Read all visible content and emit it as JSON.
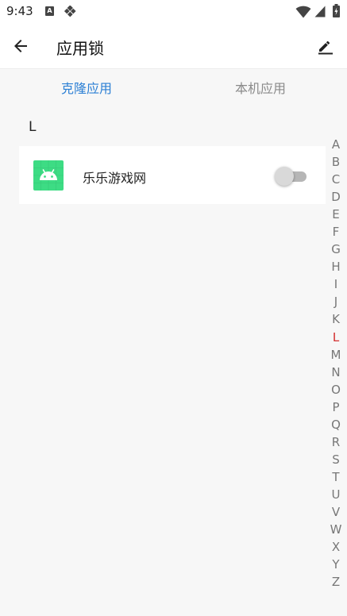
{
  "status_bar": {
    "time": "9:43",
    "a_badge": "A"
  },
  "toolbar": {
    "title": "应用锁",
    "back_icon": "arrow-left-icon",
    "edit_icon": "pencil-icon"
  },
  "tabs": [
    {
      "label": "克隆应用",
      "active": true
    },
    {
      "label": "本机应用",
      "active": false
    }
  ],
  "section": {
    "letter": "L"
  },
  "apps": [
    {
      "name": "乐乐游戏网",
      "icon": "android-icon",
      "locked": false
    }
  ],
  "side_index": {
    "letters": [
      "A",
      "B",
      "C",
      "D",
      "E",
      "F",
      "G",
      "H",
      "I",
      "J",
      "K",
      "L",
      "M",
      "N",
      "O",
      "P",
      "Q",
      "R",
      "S",
      "T",
      "U",
      "V",
      "W",
      "X",
      "Y",
      "Z"
    ],
    "active": "L"
  },
  "colors": {
    "accent": "#2b7fd4",
    "inactive_tab": "#8a8a8a",
    "active_index": "#d32f2f",
    "android_green": "#3ddc84"
  }
}
